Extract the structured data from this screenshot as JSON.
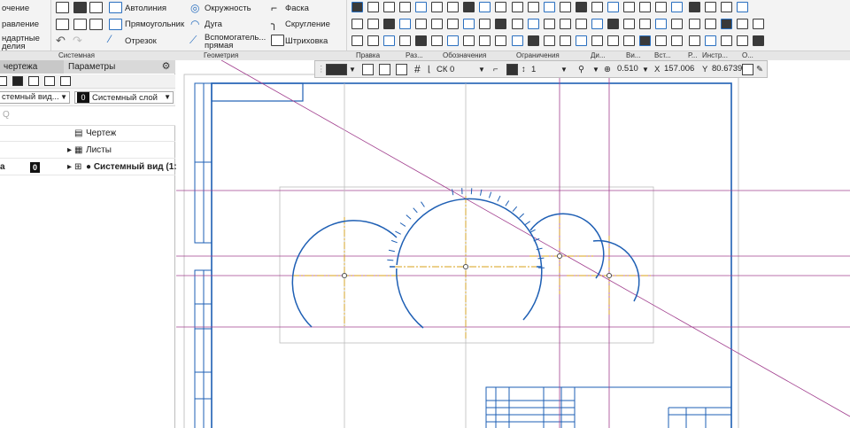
{
  "ribbon": {
    "col1": [
      "очение",
      "равление",
      "ндартные",
      "делия"
    ],
    "col3": [
      "Автолиния",
      "Прямоугольник",
      "Отрезок"
    ],
    "col4": [
      "Окружность",
      "Дуга",
      "Вспомогатель...",
      "прямая"
    ],
    "col5": [
      "Фаска",
      "Скругление",
      "Штриховка"
    ],
    "sections": [
      "Системная",
      "Геометрия",
      "Правка",
      "Раз...",
      "Обозначения",
      "Ограничения",
      "Ди...",
      "Ви...",
      "Вст...",
      "Р...",
      "Инстр...",
      "О..."
    ]
  },
  "panel": {
    "tab_drawing": "чертежа",
    "tab_params": "Параметры",
    "view_combo": "стемный вид...",
    "layer_num": "0",
    "layer_combo": "Системный слой",
    "search_placeholder": "Q",
    "tree": [
      {
        "label": "Чертеж"
      },
      {
        "label": "Листы",
        "expand": "▸"
      },
      {
        "label": "● Системный вид (1:1",
        "expand": "▸",
        "badge": "0",
        "prefix": "а"
      }
    ]
  },
  "float_toolbar": {
    "cs": "СК 0",
    "step": "1",
    "zoom": "0.510",
    "x_label": "X",
    "x_value": "157.006",
    "y_label": "Y",
    "y_value": "80.6739"
  },
  "colors": {
    "frame": "#1e5fb4",
    "geometry": "#1e5fb4",
    "constr": "#a2408f",
    "axis": "#d8a11a",
    "hatch_marks": "#1e5fb4"
  }
}
